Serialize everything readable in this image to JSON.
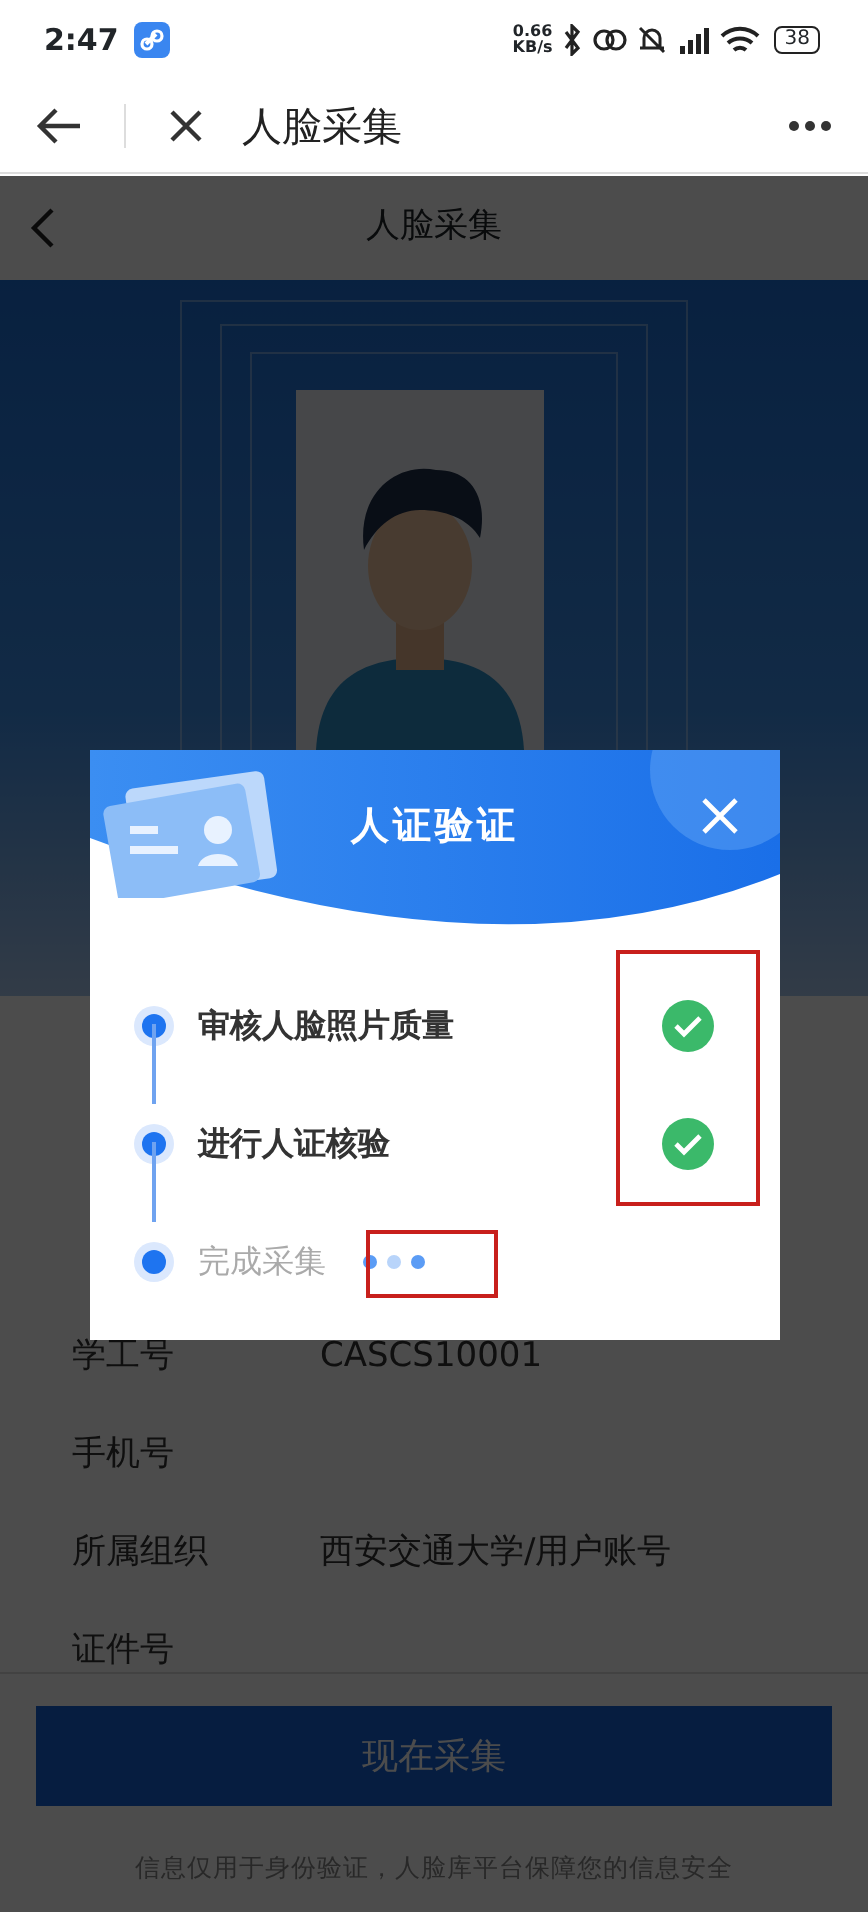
{
  "status_bar": {
    "time": "2:47",
    "net_speed": "0.66",
    "net_unit": "KB/s",
    "battery": "38"
  },
  "browser_bar": {
    "title": "人脸采集"
  },
  "page_header": {
    "title": "人脸采集"
  },
  "info_rows": [
    {
      "label": "学工号",
      "value": "CASCS10001"
    },
    {
      "label": "手机号"
    },
    {
      "label": "所属组织",
      "value": "西安交通大学/用户账号"
    },
    {
      "label": "证件号"
    }
  ],
  "primary_button": "现在采集",
  "footer_note": "信息仅用于身份验证，人脸库平台保障您的信息安全",
  "dialog": {
    "title": "人证验证",
    "steps": [
      {
        "label": "审核人脸照片质量",
        "kind": "done"
      },
      {
        "label": "进行人证核验",
        "kind": "done"
      },
      {
        "label": "完成采集",
        "kind": "pending"
      }
    ]
  }
}
